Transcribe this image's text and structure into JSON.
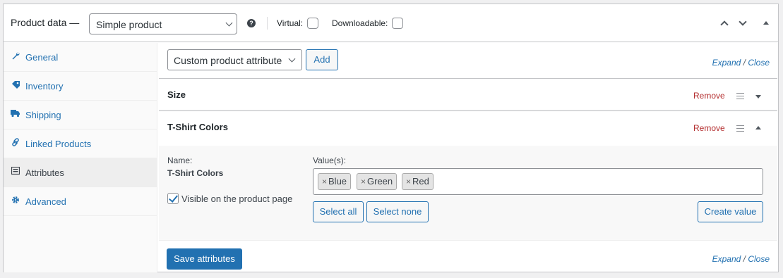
{
  "header": {
    "title": "Product data —",
    "product_type": "Simple product",
    "help_icon": "help-icon",
    "virtual_label": "Virtual:",
    "downloadable_label": "Downloadable:",
    "virtual_checked": false,
    "downloadable_checked": false
  },
  "sidebar": {
    "items": [
      {
        "label": "General",
        "icon": "wrench-icon",
        "active": false
      },
      {
        "label": "Inventory",
        "icon": "tag-icon",
        "active": false
      },
      {
        "label": "Shipping",
        "icon": "truck-icon",
        "active": false
      },
      {
        "label": "Linked Products",
        "icon": "link-icon",
        "active": false
      },
      {
        "label": "Attributes",
        "icon": "list-icon",
        "active": true
      },
      {
        "label": "Advanced",
        "icon": "gear-icon",
        "active": false
      }
    ]
  },
  "toolbar": {
    "attribute_select": "Custom product attribute",
    "add_label": "Add",
    "expand_label": "Expand",
    "close_label": "Close"
  },
  "attributes": [
    {
      "name": "Size",
      "remove_label": "Remove",
      "expanded": false
    },
    {
      "name": "T-Shirt Colors",
      "remove_label": "Remove",
      "expanded": true,
      "name_label": "Name:",
      "name_value": "T-Shirt Colors",
      "visible_label": "Visible on the product page",
      "visible_checked": true,
      "values_label": "Value(s):",
      "values": [
        "Blue",
        "Green",
        "Red"
      ],
      "select_all_label": "Select all",
      "select_none_label": "Select none",
      "create_value_label": "Create value"
    }
  ],
  "footer": {
    "save_label": "Save attributes",
    "expand_label": "Expand",
    "close_label": "Close"
  },
  "colors": {
    "accent": "#2271b1",
    "remove": "#b32d2e",
    "border": "#c3c4c7"
  }
}
